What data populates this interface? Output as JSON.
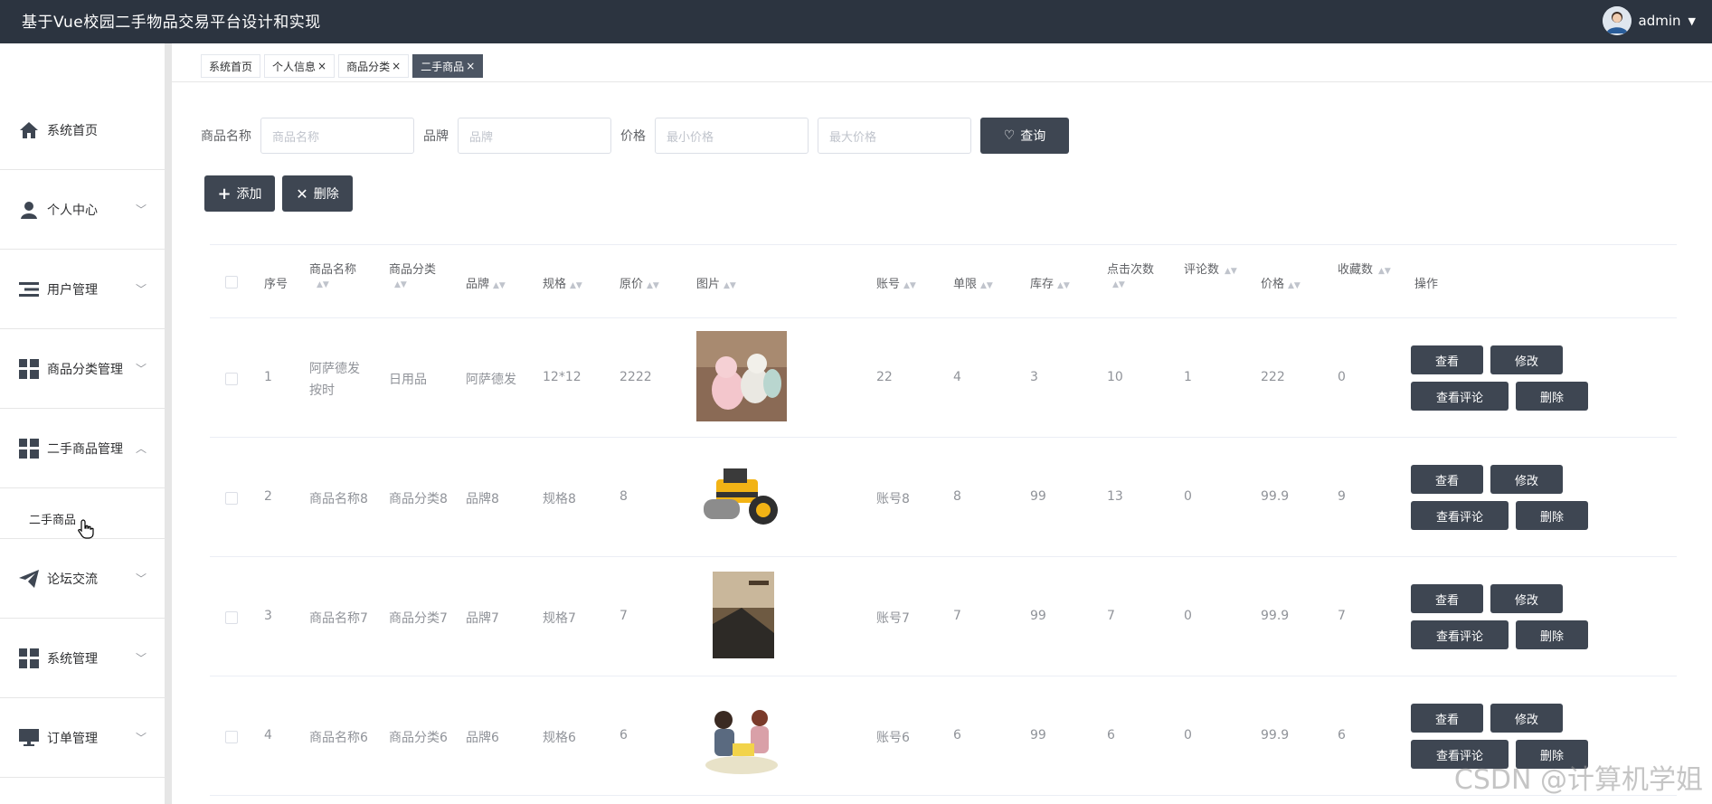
{
  "app": {
    "title": "基于Vue校园二手物品交易平台设计和实现",
    "user": "admin",
    "accent": "#2c3440",
    "button_color": "#3e4652"
  },
  "sidebar": {
    "items": [
      {
        "label": "系统首页",
        "icon": "home-icon"
      },
      {
        "label": "个人中心",
        "icon": "user-icon"
      },
      {
        "label": "用户管理",
        "icon": "list-icon"
      },
      {
        "label": "商品分类管理",
        "icon": "grid-icon"
      },
      {
        "label": "二手商品管理",
        "icon": "grid-icon"
      },
      {
        "label": "论坛交流",
        "icon": "send-icon"
      },
      {
        "label": "系统管理",
        "icon": "grid-icon"
      },
      {
        "label": "订单管理",
        "icon": "monitor-icon"
      }
    ],
    "sub_item": "二手商品"
  },
  "tabs": [
    {
      "label": "系统首页"
    },
    {
      "label": "个人信息"
    },
    {
      "label": "商品分类"
    },
    {
      "label": "二手商品"
    }
  ],
  "search": {
    "name_label": "商品名称",
    "name_placeholder": "商品名称",
    "brand_label": "品牌",
    "brand_placeholder": "品牌",
    "price_label": "价格",
    "min_placeholder": "最小价格",
    "max_placeholder": "最大价格",
    "query_button": "查询"
  },
  "actions": {
    "add": "添加",
    "delete": "删除"
  },
  "table": {
    "headers": [
      "序号",
      "商品名称",
      "商品分类",
      "品牌",
      "规格",
      "原价",
      "图片",
      "账号",
      "单限",
      "库存",
      "点击次数",
      "评论数",
      "价格",
      "收藏数",
      "操作"
    ],
    "rows": [
      {
        "no": "1",
        "name": "阿萨德发按时",
        "category": "日用品",
        "brand": "阿萨德发",
        "spec": "12*12",
        "orig": "2222",
        "account": "22",
        "limit": "4",
        "stock": "3",
        "clicks": "10",
        "comments": "1",
        "price": "222",
        "favs": "0"
      },
      {
        "no": "2",
        "name": "商品名称8",
        "category": "商品分类8",
        "brand": "品牌8",
        "spec": "规格8",
        "orig": "8",
        "account": "账号8",
        "limit": "8",
        "stock": "99",
        "clicks": "13",
        "comments": "0",
        "price": "99.9",
        "favs": "9"
      },
      {
        "no": "3",
        "name": "商品名称7",
        "category": "商品分类7",
        "brand": "品牌7",
        "spec": "规格7",
        "orig": "7",
        "account": "账号7",
        "limit": "7",
        "stock": "99",
        "clicks": "7",
        "comments": "0",
        "price": "99.9",
        "favs": "7"
      },
      {
        "no": "4",
        "name": "商品名称6",
        "category": "商品分类6",
        "brand": "品牌6",
        "spec": "规格6",
        "orig": "6",
        "account": "账号6",
        "limit": "6",
        "stock": "99",
        "clicks": "6",
        "comments": "0",
        "price": "99.9",
        "favs": "6"
      }
    ],
    "ops": {
      "view": "查看",
      "edit": "修改",
      "view_comments": "查看评论",
      "delete": "删除"
    }
  },
  "watermark": "CSDN @计算机学姐"
}
